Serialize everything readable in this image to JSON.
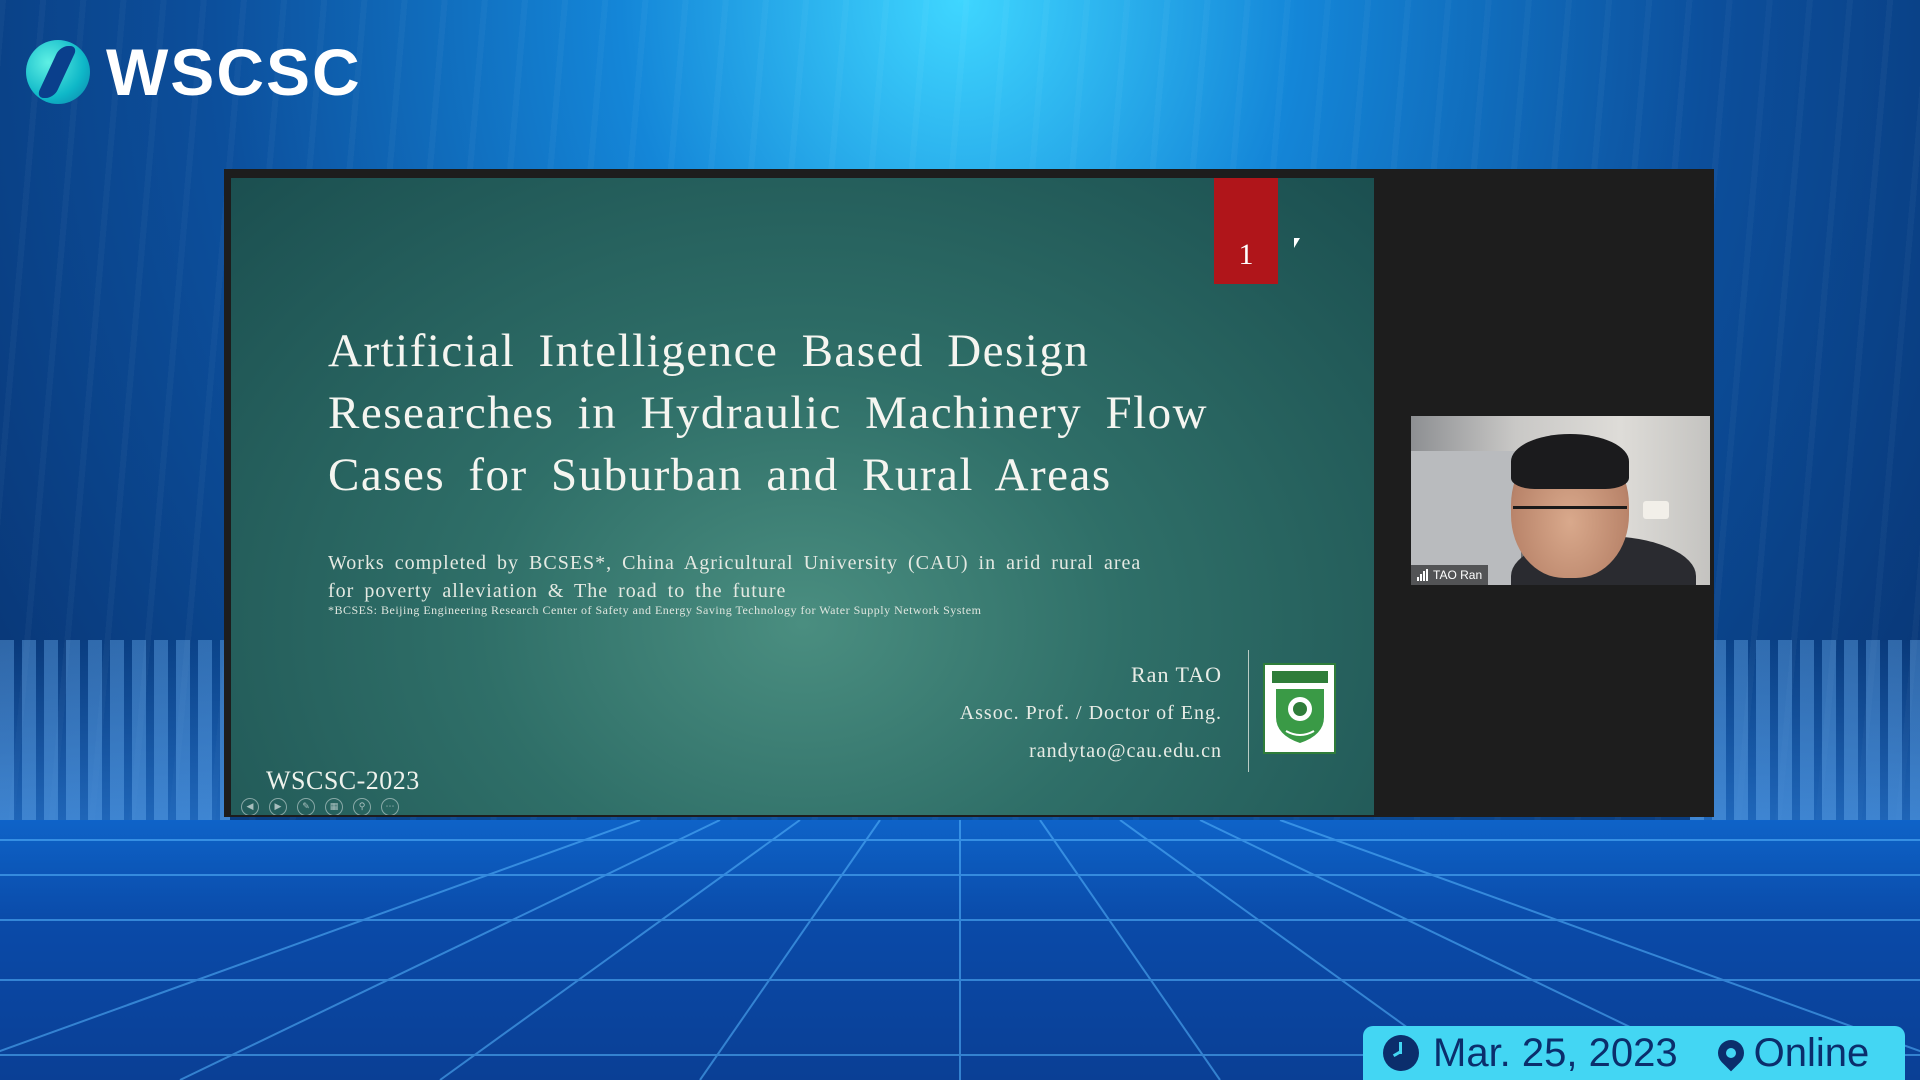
{
  "brand": {
    "name": "WSCSC"
  },
  "slide": {
    "number": "1",
    "title_lines": [
      "Artificial Intelligence Based Design",
      "Researches in Hydraulic Machinery Flow",
      "Cases for Suburban and Rural Areas"
    ],
    "subtitle_line1": "Works completed by BCSES*, China Agricultural University (CAU) in arid rural area",
    "subtitle_line2": "for poverty alleviation & The road to the future",
    "footnote": "*BCSES: Beijing Engineering Research Center of Safety and Energy Saving Technology for Water Supply Network System",
    "author_name": "Ran TAO",
    "author_title": "Assoc. Prof. / Doctor of Eng.",
    "author_email": "randytao@cau.edu.cn",
    "footer": "WSCSC-2023",
    "controls": [
      {
        "name": "prev-slide-icon",
        "glyph": "◀"
      },
      {
        "name": "next-slide-icon",
        "glyph": "▶"
      },
      {
        "name": "pen-icon",
        "glyph": "✎"
      },
      {
        "name": "slides-grid-icon",
        "glyph": "▦"
      },
      {
        "name": "zoom-icon",
        "glyph": "⚲"
      },
      {
        "name": "more-options-icon",
        "glyph": "⋯"
      }
    ]
  },
  "video": {
    "participant_label": "TAO Ran"
  },
  "info_bar": {
    "date": "Mar. 25, 2023",
    "location": "Online"
  },
  "colors": {
    "accent": "#43d6f3",
    "slide_number_bg": "#b0151a",
    "info_text": "#0b2e6c"
  }
}
